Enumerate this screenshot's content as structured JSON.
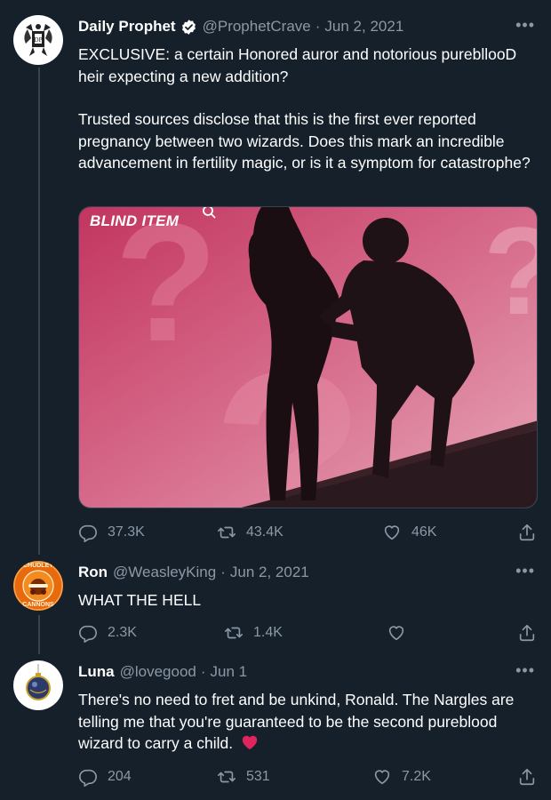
{
  "tweets": [
    {
      "name": "Daily Prophet",
      "handle": "@ProphetCrave",
      "date": "Jun 2, 2021",
      "verified": true,
      "paragraphs": [
        "EXCLUSIVE: a certain Honored auror and notorious purebllooD heir expecting a new addition?",
        "Trusted sources disclose that this is the first ever reported pregnancy between two wizards. Does this mark an incredible advancement in fertility magic, or is it a symptom for catastrophe?"
      ],
      "media_label": "BLIND ITEM",
      "replies": "37.3K",
      "retweets": "43.4K",
      "likes": "46K"
    },
    {
      "name": "Ron",
      "handle": "@WeasleyKing",
      "date": "Jun 2, 2021",
      "text": "WHAT THE HELL",
      "avatar_text_top": "CHUDLEY",
      "avatar_text_bottom": "CANNONS",
      "replies": "2.3K",
      "retweets": "1.4K",
      "likes": ""
    },
    {
      "name": "Luna",
      "handle": "@lovegood",
      "date": "Jun 1",
      "text": "There's no need to fret and be unkind, Ronald. The Nargles are telling me that you're guaranteed to be the second pureblood wizard to carry a child.",
      "emoji": "❤️",
      "replies": "204",
      "retweets": "531",
      "likes": "7.2K"
    }
  ],
  "colors": {
    "background": "#15202b",
    "muted": "#8b98a5",
    "thread": "#38444d",
    "verified": "#ffffff",
    "heart": "#e0245e"
  },
  "icons": [
    "reply-icon",
    "retweet-icon",
    "like-icon",
    "share-icon",
    "more-icon",
    "verified-icon"
  ]
}
